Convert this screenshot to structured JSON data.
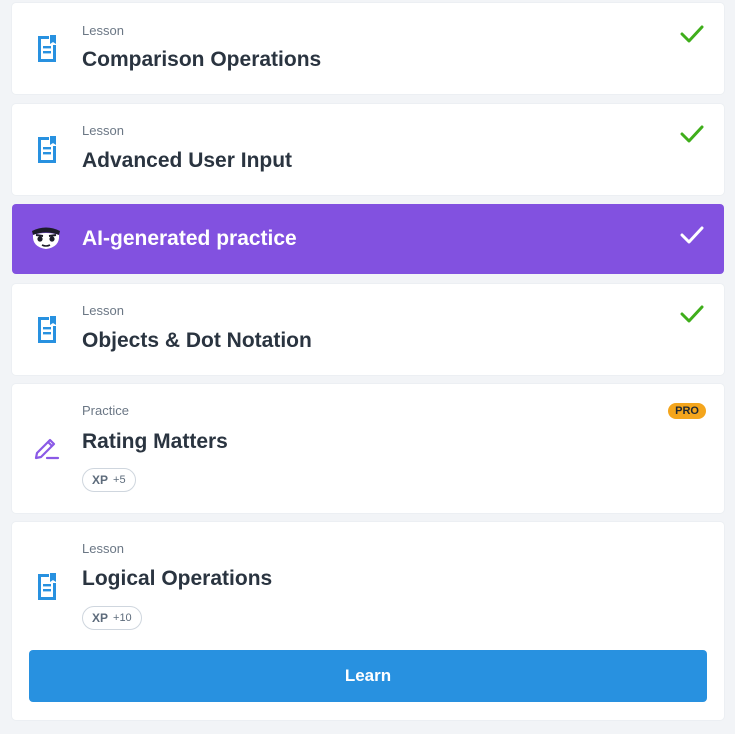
{
  "colors": {
    "accent_blue": "#2891e0",
    "check_green": "#3fae1b",
    "ai_purple": "#8251e0",
    "pro_orange": "#f4a51c",
    "pencil_purple": "#8a59e6"
  },
  "items": [
    {
      "kind": "Lesson",
      "title": "Comparison Operations",
      "icon": "lesson-document-icon",
      "completed": true
    },
    {
      "kind": "Lesson",
      "title": "Advanced User Input",
      "icon": "lesson-document-icon",
      "completed": true
    },
    {
      "kind": "",
      "title": "AI-generated practice",
      "icon": "ai-mascot-icon",
      "completed": true
    },
    {
      "kind": "Lesson",
      "title": "Objects & Dot Notation",
      "icon": "lesson-document-icon",
      "completed": true
    },
    {
      "kind": "Practice",
      "title": "Rating Matters",
      "icon": "pencil-icon",
      "badge": "PRO",
      "xp_label": "XP",
      "xp_value": "+5"
    },
    {
      "kind": "Lesson",
      "title": "Logical Operations",
      "icon": "lesson-document-icon",
      "xp_label": "XP",
      "xp_value": "+10",
      "button_label": "Learn"
    }
  ]
}
